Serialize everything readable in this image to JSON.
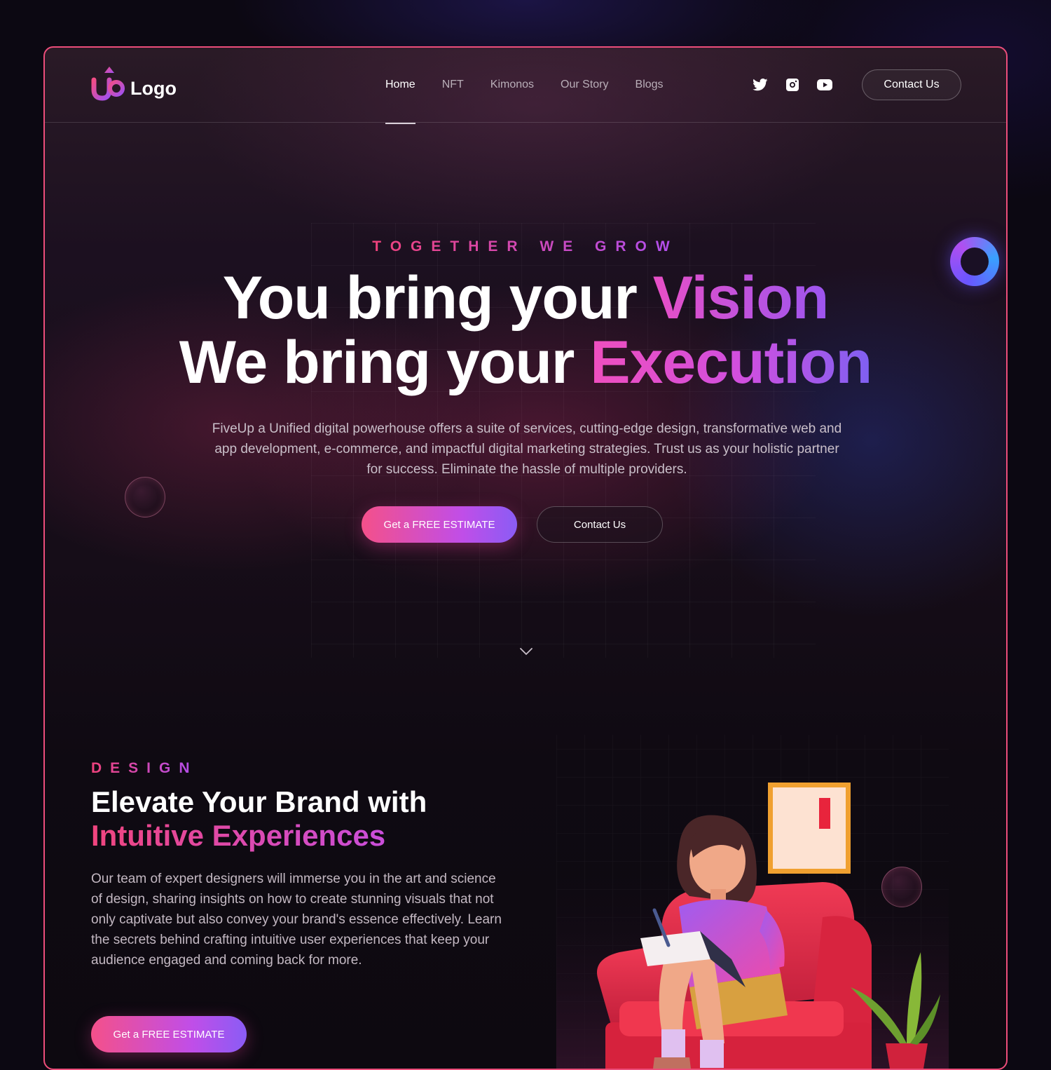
{
  "header": {
    "logo_text": "Logo",
    "nav": [
      {
        "label": "Home",
        "active": true
      },
      {
        "label": "NFT",
        "active": false
      },
      {
        "label": "Kimonos",
        "active": false
      },
      {
        "label": "Our Story",
        "active": false
      },
      {
        "label": "Blogs",
        "active": false
      }
    ],
    "socials": [
      "twitter-icon",
      "instagram-icon",
      "youtube-icon"
    ],
    "contact_label": "Contact Us"
  },
  "hero": {
    "eyebrow": "TOGETHER WE GROW",
    "line1_prefix": "You bring your ",
    "line1_highlight": "Vision",
    "line2_prefix": "We bring your ",
    "line2_highlight": "Execution",
    "description": "FiveUp a Unified digital powerhouse offers a suite of services, cutting-edge design, transformative web and app development, e-commerce, and impactful digital marketing strategies. Trust us as your holistic partner for success. Eliminate the hassle of multiple providers.",
    "primary_cta": "Get a FREE ESTIMATE",
    "secondary_cta": "Contact Us"
  },
  "design_section": {
    "eyebrow": "DESIGN",
    "title_line1": "Elevate Your Brand with",
    "title_line2": "Intuitive Experiences",
    "description": "Our team of expert designers will immerse you in the art and science of design, sharing insights on how to create stunning visuals that not only captivate but also convey your brand's essence effectively. Learn the secrets behind crafting intuitive user experiences that keep your audience engaged and coming back for more.",
    "cta": "Get a FREE ESTIMATE"
  },
  "colors": {
    "frame_border": "#ec4d7a",
    "accent_pink": "#f0427c",
    "accent_purple": "#9c55f0"
  }
}
